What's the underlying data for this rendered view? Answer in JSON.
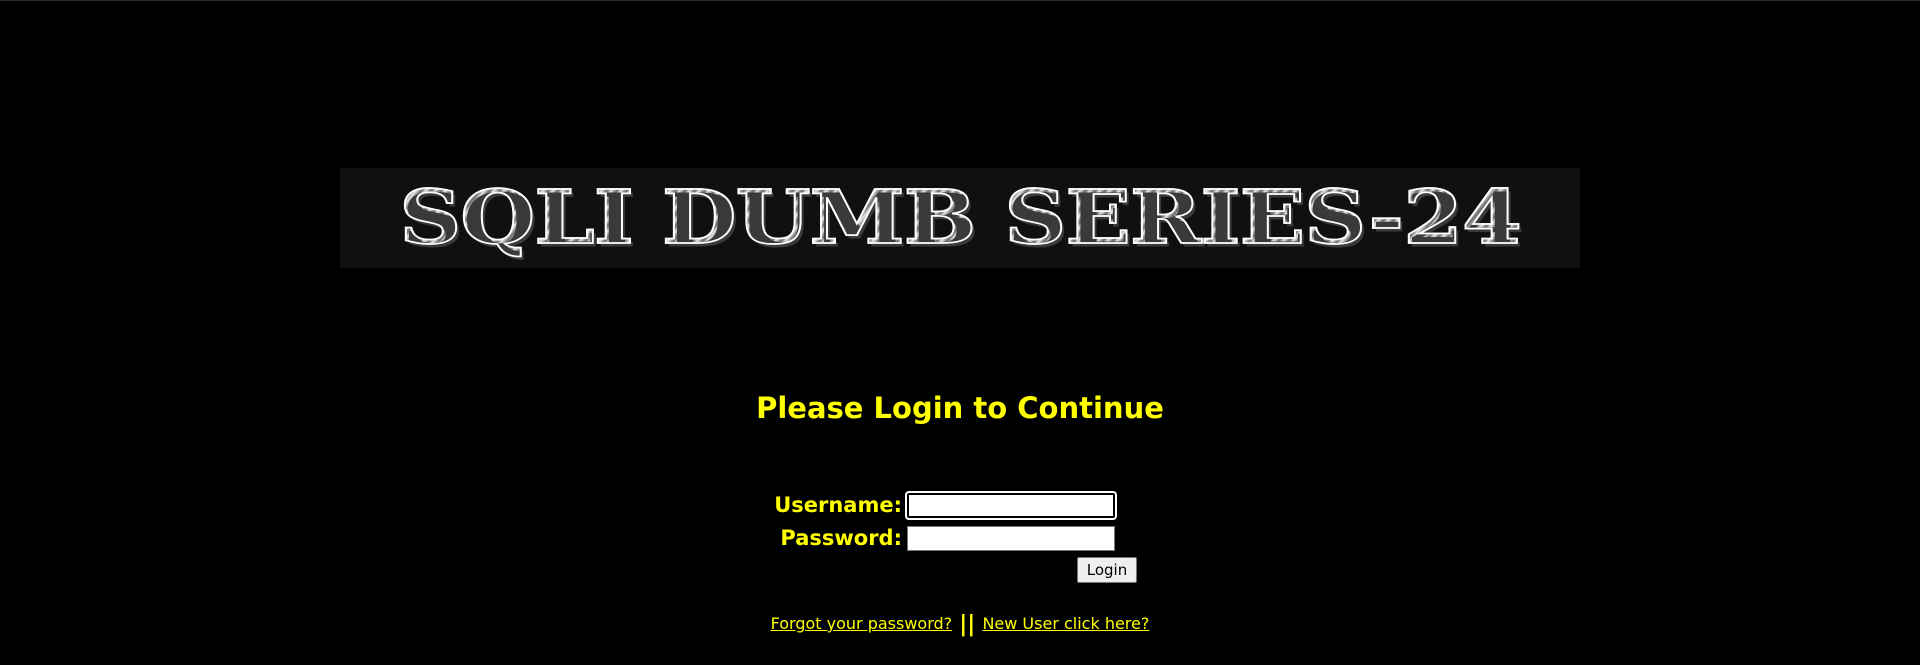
{
  "banner": {
    "title": "SQLI DUMB SERIES-24"
  },
  "heading": "Please Login to Continue",
  "form": {
    "username_label": "Username:",
    "username_value": "",
    "password_label": "Password:",
    "password_value": "",
    "login_button": "Login"
  },
  "links": {
    "forgot_password": "Forgot your password?",
    "separator": "||",
    "new_user": "New User click here?"
  },
  "colors": {
    "background": "#000000",
    "text": "#ffff00"
  }
}
